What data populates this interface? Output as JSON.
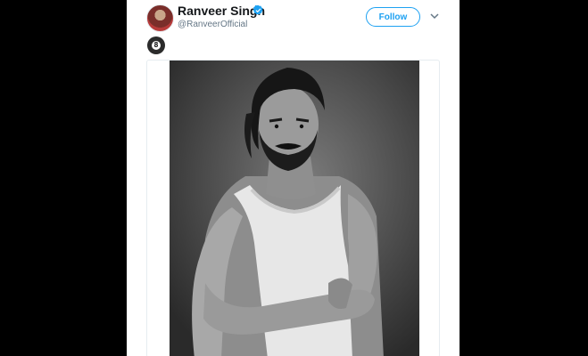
{
  "tweet": {
    "author_name": "Ranveer Singh",
    "author_handle": "@RanveerOfficial",
    "follow_label": "Follow",
    "emoji_text": "8",
    "icons": {
      "verified": "verified-badge-icon",
      "menu": "chevron-down-icon",
      "emoji": "eight-ball-icon"
    },
    "colors": {
      "accent": "#1da1f2",
      "name": "#14171a",
      "handle": "#657786"
    }
  }
}
